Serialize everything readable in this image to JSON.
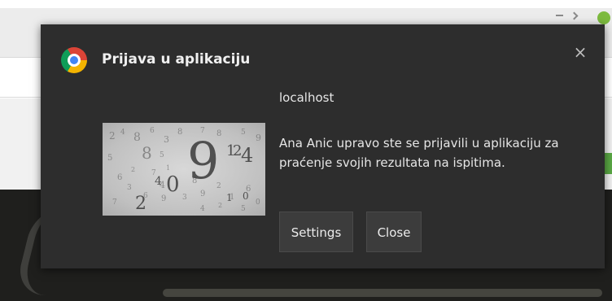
{
  "notification": {
    "app_icon": "chrome-icon",
    "title": "Prijava u aplikaciju",
    "close_icon": "close-icon",
    "close_glyph": "×",
    "origin": "localhost",
    "message": "Ana Anic upravo ste se prijavili u aplikaciju za praćenje svojih rezultata na ispitima.",
    "image": "numbers-collage-image",
    "buttons": {
      "settings_label": "Settings",
      "close_label": "Close"
    }
  },
  "colors": {
    "notification_bg": "#2d2d2d",
    "button_bg": "#3c3c3c",
    "text": "#e6e6e6"
  }
}
